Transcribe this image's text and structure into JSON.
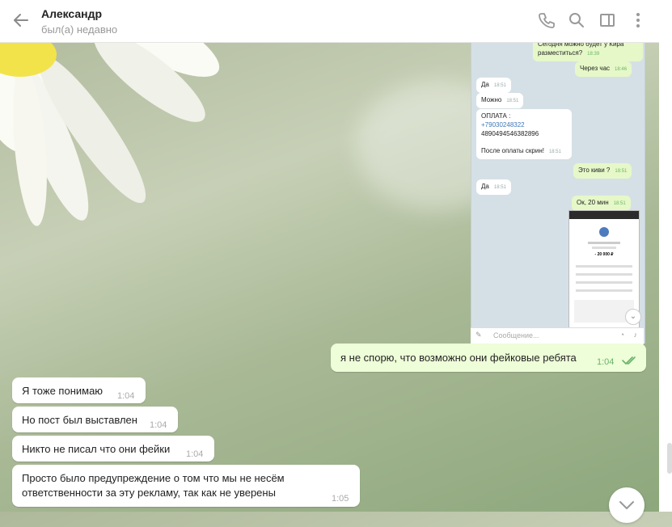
{
  "header": {
    "name": "Александр",
    "status": "был(а) недавно"
  },
  "embed": {
    "msgs": {
      "m1": {
        "text": "Сегодня можно будет у Кира разместиться?",
        "time": "18:39"
      },
      "m2": {
        "text": "Через час",
        "time": "18:46"
      },
      "m3": {
        "text": "Да",
        "time": "18:51"
      },
      "m4": {
        "text": "Можно",
        "time": "18:51"
      },
      "m5": {
        "line1": "ОПЛАТА :",
        "phone": "+79030248322",
        "card": "4890494546382896",
        "after": "После оплаты скрин!",
        "time": "18:51"
      },
      "m6": {
        "text": "Это киви ?",
        "time": "18:51"
      },
      "m7": {
        "text": "Да",
        "time": "18:51"
      },
      "m8": {
        "text": "Ок, 20 мин",
        "time": "18:51"
      }
    },
    "phone": {
      "amount": "- 20 000 ₽"
    },
    "input_placeholder": "Сообщение..."
  },
  "messages": {
    "outgoing": {
      "text": "я не спорю, что возможно они фейковые ребята",
      "time": "1:04"
    },
    "in1": {
      "text": "Я тоже понимаю",
      "time": "1:04"
    },
    "in2": {
      "text": "Но пост был выставлен",
      "time": "1:04"
    },
    "in3": {
      "text": "Никто не писал что они фейки",
      "time": "1:04"
    },
    "in4": {
      "line1": "Просто было предупреждение о том что мы не несём",
      "line2": "ответственности за эту рекламу, так как не уверены",
      "time": "1:05"
    }
  },
  "colors": {
    "accent": "#4f9bdc",
    "outgoing_bubble": "#eefed8",
    "read_check": "#6ab36b"
  }
}
